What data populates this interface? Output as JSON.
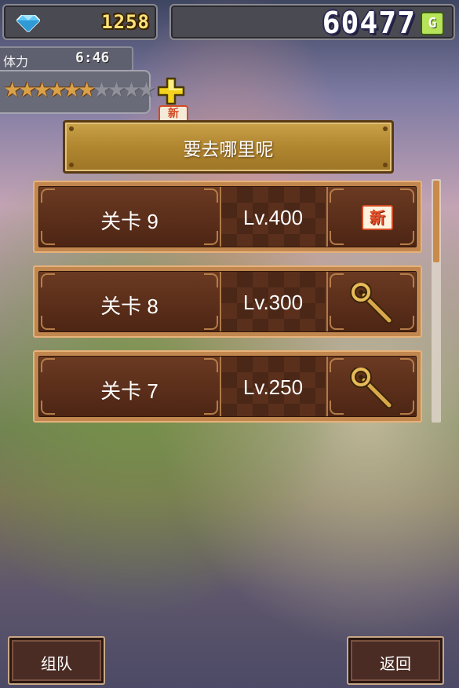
{
  "top_bar": {
    "gems": "1258",
    "gold": "60477",
    "gold_unit": "G"
  },
  "stamina": {
    "label": "体力",
    "timer": "6:46",
    "stars_filled": 6,
    "stars_total": 10,
    "new_badge": "新"
  },
  "header": {
    "title": "要去哪里呢"
  },
  "levels": [
    {
      "name": "关卡 9",
      "level": "Lv.400",
      "icon": "new-badge",
      "badge_text": "新"
    },
    {
      "name": "关卡 8",
      "level": "Lv.300",
      "icon": "staff-icon"
    },
    {
      "name": "关卡 7",
      "level": "Lv.250",
      "icon": "staff-icon"
    }
  ],
  "buttons": {
    "team": "组队",
    "back": "返回"
  },
  "colors": {
    "gold_accent": "#c9a24a",
    "row_brown": "#5a2f1c",
    "badge_red": "#d24b24"
  }
}
